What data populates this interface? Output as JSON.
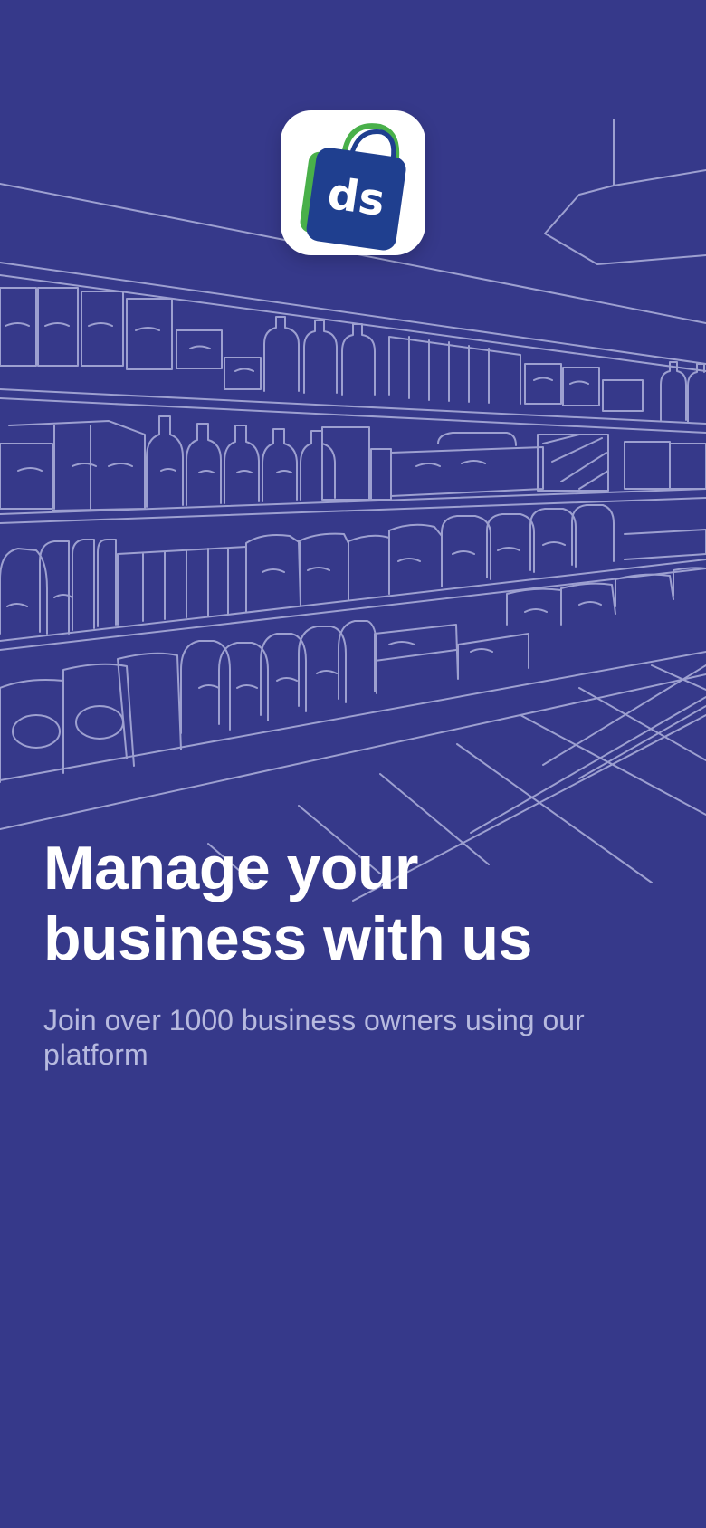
{
  "app": {
    "logo_text": "ds",
    "logo_icon": "shopping-bag-icon"
  },
  "onboarding": {
    "title": "Manage your business with us",
    "subtitle": "Join over 1000 business owners using our platform"
  },
  "colors": {
    "background": "#36398a",
    "sketch_lines": "#a9acd8",
    "title": "#ffffff",
    "subtitle": "#b7badf",
    "logo_bag": "#1f3f8f",
    "logo_green": "#49b04a"
  }
}
